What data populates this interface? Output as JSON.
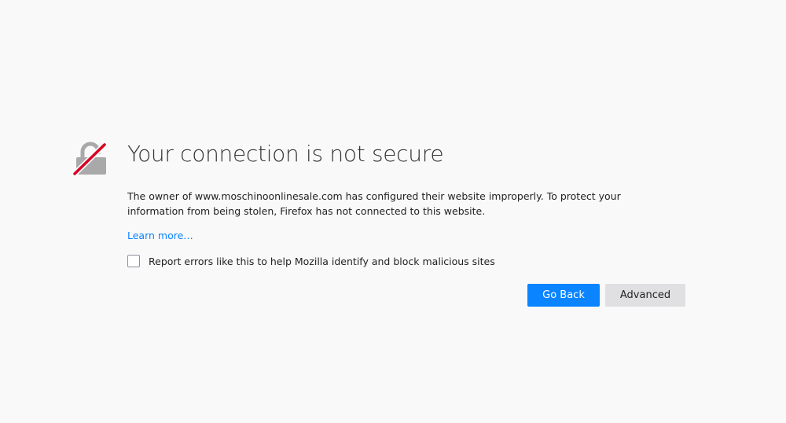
{
  "colors": {
    "background": "#f9f9fa",
    "accent": "#0a84ff",
    "link": "#0a84ff",
    "secondary_button": "#e0e0e2",
    "lock_gray": "#a9a9a9",
    "strike_red": "#d70022"
  },
  "icons": {
    "header": "broken-lock-icon"
  },
  "error": {
    "title": "Your connection is not secure",
    "description": "The owner of www.moschinoonlinesale.com has configured their website improperly. To protect your information from being stolen, Firefox has not connected to this website.",
    "learn_more": "Learn more…",
    "report_label": "Report errors like this to help Mozilla identify and block malicious sites",
    "report_checked": false
  },
  "buttons": {
    "go_back": "Go Back",
    "advanced": "Advanced"
  }
}
